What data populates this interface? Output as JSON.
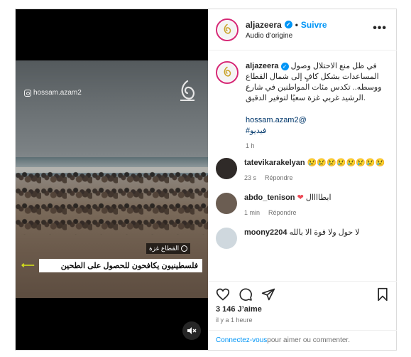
{
  "post": {
    "username": "aljazeera",
    "follow_label": "Suivre",
    "audio_label": "Audio d’origine",
    "more_label": "•••"
  },
  "video": {
    "watermark_handle": "hossam.azam2",
    "place_tag": "القطاع غزة",
    "headline": "فلسطينيون يكافحون للحصول على الطحين",
    "mute_icon": "speaker-muted-icon"
  },
  "caption": {
    "username": "aljazeera",
    "text": "في ظل منع الاحتلال وصول المساعدات بشكل كافٍ إلى شمال القطاع ووسطه.. تكدس مئات المواطنين في شارع الرشيد غربي غزة سعيًا لتوفير الدقيق.",
    "mention": "hossam.azam2@",
    "hashtag": "#فيديو",
    "time": "1 h"
  },
  "comments": [
    {
      "username": "tatevikarakelyan",
      "text": "😢😢😢😢😢😢😢😢",
      "time": "23 s",
      "reply": "Répondre",
      "avatar_color": "#2f2a28"
    },
    {
      "username": "abdo_tenison",
      "text": "ابطاااال",
      "time": "1 min",
      "reply": "Répondre",
      "avatar_color": "#6b5d52"
    },
    {
      "username": "moony2204",
      "text": "لا حول ولا قوة الا بالله",
      "time": "",
      "reply": "",
      "avatar_color": "#cfd8de"
    }
  ],
  "engagement": {
    "likes": "3 146 J’aime",
    "timestamp": "il y a 1 heure"
  },
  "comment_prompt": {
    "login_link": "Connectez-vous",
    "rest": " pour aimer ou commenter."
  }
}
